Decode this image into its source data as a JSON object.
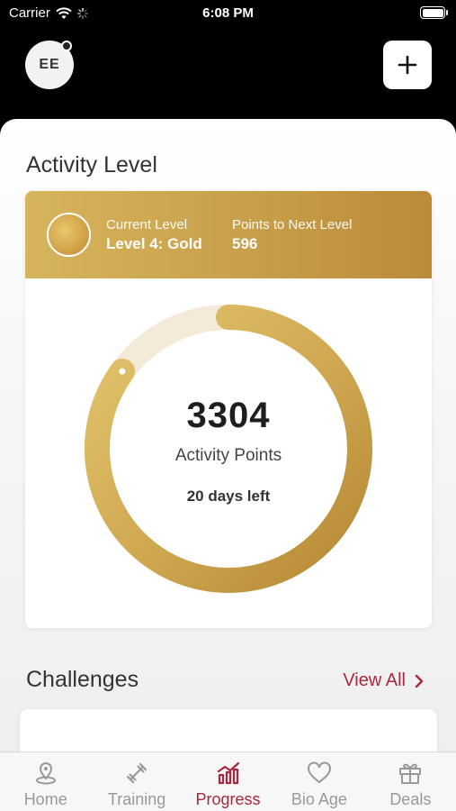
{
  "status_bar": {
    "carrier": "Carrier",
    "time": "6:08 PM"
  },
  "header": {
    "avatar_initials": "EE"
  },
  "activity": {
    "title": "Activity Level",
    "current_level_label": "Current Level",
    "current_level_value": "Level 4: Gold",
    "next_level_label": "Points to Next Level",
    "next_level_value": "596",
    "points": "3304",
    "points_label": "Activity Points",
    "days_left": "20 days left",
    "progress_fraction": 0.85,
    "colors": {
      "gold_light": "#e0c46c",
      "gold_dark": "#b98a37",
      "track": "#f3ebd7"
    }
  },
  "challenges": {
    "title": "Challenges",
    "view_all": "View All"
  },
  "tabs": [
    {
      "label": "Home",
      "icon": "home-pin-icon"
    },
    {
      "label": "Training",
      "icon": "dumbbell-icon"
    },
    {
      "label": "Progress",
      "icon": "chart-icon"
    },
    {
      "label": "Bio Age",
      "icon": "heart-icon"
    },
    {
      "label": "Deals",
      "icon": "gift-icon"
    }
  ],
  "accent_color": "#a8283e"
}
